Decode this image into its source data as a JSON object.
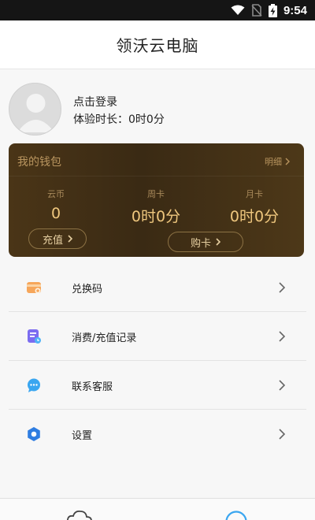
{
  "status_bar": {
    "time": "9:54",
    "icons": [
      "wifi-icon",
      "no-sim-icon",
      "battery-charging-icon"
    ]
  },
  "app": {
    "title": "领沃云电脑"
  },
  "profile": {
    "login_label": "点击登录",
    "trial_label": "体验时长：",
    "trial_value": "0时0分"
  },
  "wallet": {
    "title": "我的钱包",
    "detail_label": "明细",
    "columns": [
      {
        "label": "云币",
        "value": "0"
      },
      {
        "label": "周卡",
        "value": "0时0分"
      },
      {
        "label": "月卡",
        "value": "0时0分"
      }
    ],
    "recharge_label": "充值",
    "buy_card_label": "购卡",
    "colors": {
      "background": "#3f2d15",
      "label": "#b9955f",
      "value": "#efc77e"
    }
  },
  "menu": [
    {
      "label": "兑换码",
      "icon": "redeem-code-icon"
    },
    {
      "label": "消费/充值记录",
      "icon": "records-icon"
    },
    {
      "label": "联系客服",
      "icon": "customer-service-icon"
    },
    {
      "label": "设置",
      "icon": "settings-icon"
    }
  ],
  "bottom_nav": {
    "tabs": [
      {
        "icon": "cloud-icon"
      },
      {
        "icon": "profile-icon"
      }
    ]
  }
}
